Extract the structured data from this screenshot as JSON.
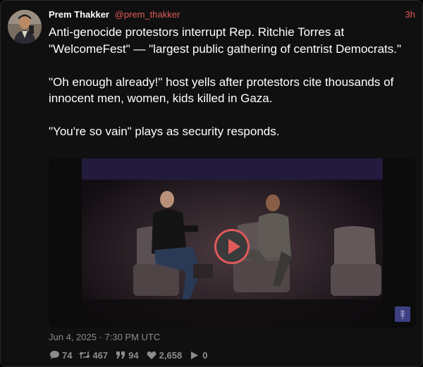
{
  "post": {
    "author_name": "Prem Thakker",
    "author_handle": "@prem_thakker",
    "time_ago": "3h",
    "paragraphs": [
      "Anti-genocide protestors interrupt Rep. Ritchie Torres at \"WelcomeFest\" — \"largest public gathering of centrist Democrats.\"",
      "\"Oh enough already!\" host yells after protestors cite thousands of innocent men, women, kids killed in Gaza.",
      "\"You're so vain\" plays as security responds."
    ],
    "date": "Jun 4, 2025 · 7:30 PM UTC"
  },
  "stats": {
    "replies": "74",
    "reposts": "467",
    "quotes": "94",
    "likes": "2,658",
    "views": "0"
  },
  "icons": {
    "reply": "speech-bubble-icon",
    "repost": "retweet-icon",
    "quote": "quote-icon",
    "like": "heart-icon",
    "views": "play-icon",
    "video_play": "play-icon"
  },
  "colors": {
    "accent": "#e05a5a",
    "muted": "#8c8c8c",
    "card_background": "#101010"
  }
}
